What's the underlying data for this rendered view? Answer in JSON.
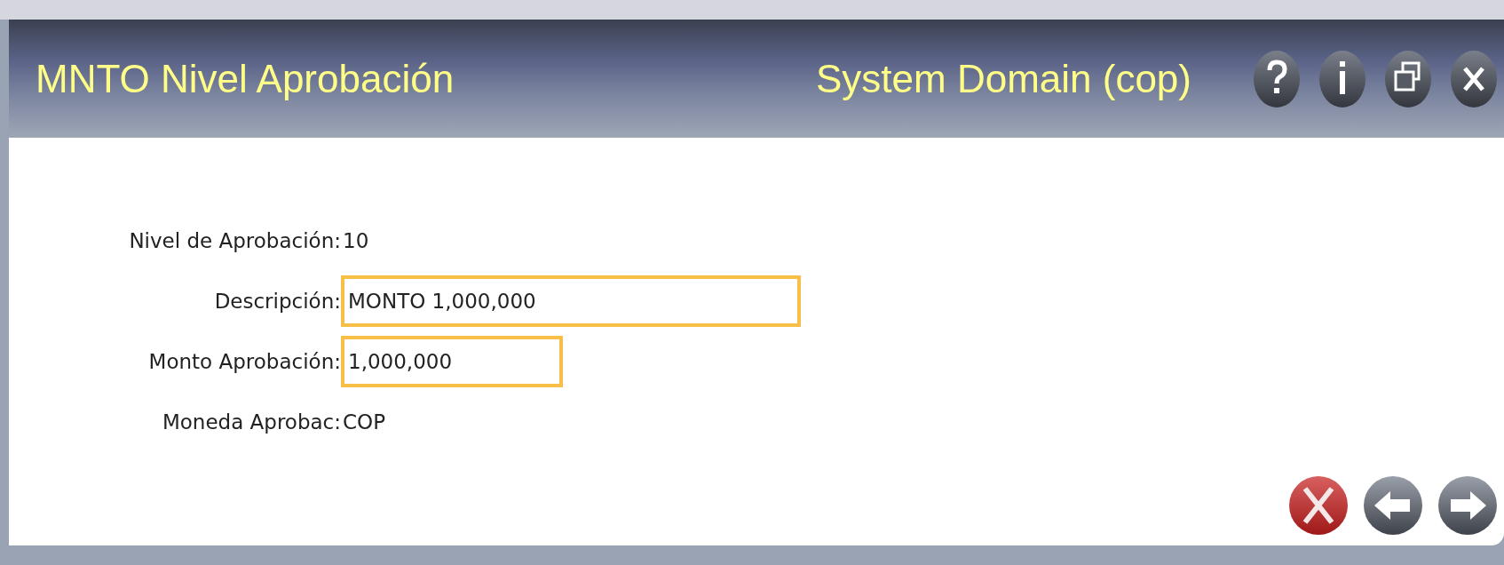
{
  "window": {
    "title": "MNTO Nivel Aprobación",
    "domain": "System Domain (cop)"
  },
  "fields": [
    {
      "kind": "static",
      "label": "Nivel de Aprobación:",
      "value": "10"
    },
    {
      "kind": "input",
      "label": "Descripción:",
      "value": "MONTO 1,000,000"
    },
    {
      "kind": "input",
      "label": "Monto Aprobación:",
      "value": "1,000,000"
    },
    {
      "kind": "static",
      "label": "Moneda Aprobac:",
      "value": "COP"
    }
  ]
}
